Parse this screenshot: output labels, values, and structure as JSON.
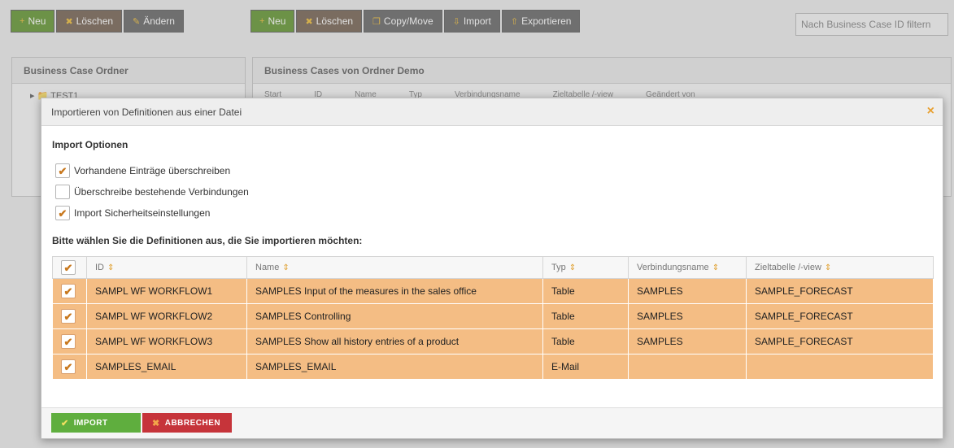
{
  "background": {
    "toolbar_left": [
      {
        "label": "Neu",
        "icon": "plus-icon"
      },
      {
        "label": "Löschen",
        "icon": "x-icon"
      },
      {
        "label": "Ändern",
        "icon": "pencil-icon"
      }
    ],
    "toolbar_right": [
      {
        "label": "Neu",
        "icon": "plus-icon"
      },
      {
        "label": "Löschen",
        "icon": "x-icon"
      },
      {
        "label": "Copy/Move",
        "icon": "copy-icon"
      },
      {
        "label": "Import",
        "icon": "import-icon"
      },
      {
        "label": "Exportieren",
        "icon": "export-icon"
      }
    ],
    "search_placeholder": "Nach Business Case ID filtern",
    "left_panel_title": "Business Case Ordner",
    "left_panel_item": "TEST1",
    "right_panel_title": "Business Cases von Ordner Demo",
    "right_panel_columns": [
      "Start",
      "ID",
      "Name",
      "Typ",
      "Verbindungsname",
      "Zieltabelle /-view",
      "Geändert von"
    ]
  },
  "dialog": {
    "title": "Importieren von Definitionen aus einer Datei",
    "close_symbol": "×",
    "options_title": "Import Optionen",
    "options": [
      {
        "label": "Vorhandene Einträge überschreiben",
        "checked": true
      },
      {
        "label": "Überschreibe bestehende Verbindungen",
        "checked": false
      },
      {
        "label": "Import Sicherheitseinstellungen",
        "checked": true
      }
    ],
    "select_title": "Bitte wählen Sie die Definitionen aus, die Sie importieren möchten:",
    "table": {
      "headers": [
        "ID",
        "Name",
        "Typ",
        "Verbindungsname",
        "Zieltabelle /-view"
      ],
      "rows": [
        {
          "id": "SAMPL WF WORKFLOW1",
          "name": "SAMPLES Input of the measures in the sales office",
          "type": "Table",
          "connection": "SAMPLES",
          "target": "SAMPLE_FORECAST",
          "checked": true
        },
        {
          "id": "SAMPL WF WORKFLOW2",
          "name": "SAMPLES Controlling",
          "type": "Table",
          "connection": "SAMPLES",
          "target": "SAMPLE_FORECAST",
          "checked": true
        },
        {
          "id": "SAMPL WF WORKFLOW3",
          "name": "SAMPLES Show all history entries of a product",
          "type": "Table",
          "connection": "SAMPLES",
          "target": "SAMPLE_FORECAST",
          "checked": true
        },
        {
          "id": "SAMPLES_EMAIL",
          "name": "SAMPLES_EMAIL",
          "type": "E-Mail",
          "connection": "",
          "target": "",
          "checked": true
        }
      ]
    },
    "buttons": {
      "import_label": "IMPORT",
      "cancel_label": "ABBRECHEN"
    }
  },
  "colors": {
    "selected_row": "#f4bd84",
    "import_button": "#5fae3e",
    "cancel_button": "#c6343a",
    "check_mark": "#c8781e"
  }
}
